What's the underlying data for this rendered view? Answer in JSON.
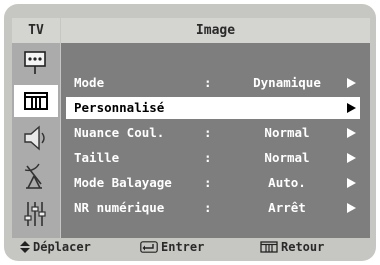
{
  "header": {
    "tab_label": "TV",
    "title": "Image"
  },
  "sidebar": {
    "items": [
      {
        "icon": "input-icon",
        "selected": false
      },
      {
        "icon": "picture-icon",
        "selected": true
      },
      {
        "icon": "sound-icon",
        "selected": false
      },
      {
        "icon": "channel-icon",
        "selected": false
      },
      {
        "icon": "setup-icon",
        "selected": false
      }
    ]
  },
  "menu": {
    "rows": [
      {
        "label": "Mode",
        "separator": ":",
        "value": "Dynamique",
        "selected": false
      },
      {
        "label": "Personnalisé",
        "separator": "",
        "value": "",
        "selected": true
      },
      {
        "label": "Nuance Coul.",
        "separator": ":",
        "value": "Normal",
        "selected": false
      },
      {
        "label": "Taille",
        "separator": ":",
        "value": "Normal",
        "selected": false
      },
      {
        "label": "Mode Balayage",
        "separator": ":",
        "value": "Auto.",
        "selected": false
      },
      {
        "label": "NR numérique",
        "separator": ":",
        "value": "Arrêt",
        "selected": false
      }
    ]
  },
  "footer": {
    "move_label": "Déplacer",
    "move_icon": "up-down-arrows-icon",
    "enter_label": "Entrer",
    "enter_icon": "enter-icon",
    "return_label": "Retour",
    "return_icon": "menu-icon"
  },
  "colors": {
    "bezel": "#c6c6c2",
    "header": "#d4d4d0",
    "sidebar": "#ababab",
    "panel": "#7e7e7e",
    "highlight": "#ffffff"
  }
}
